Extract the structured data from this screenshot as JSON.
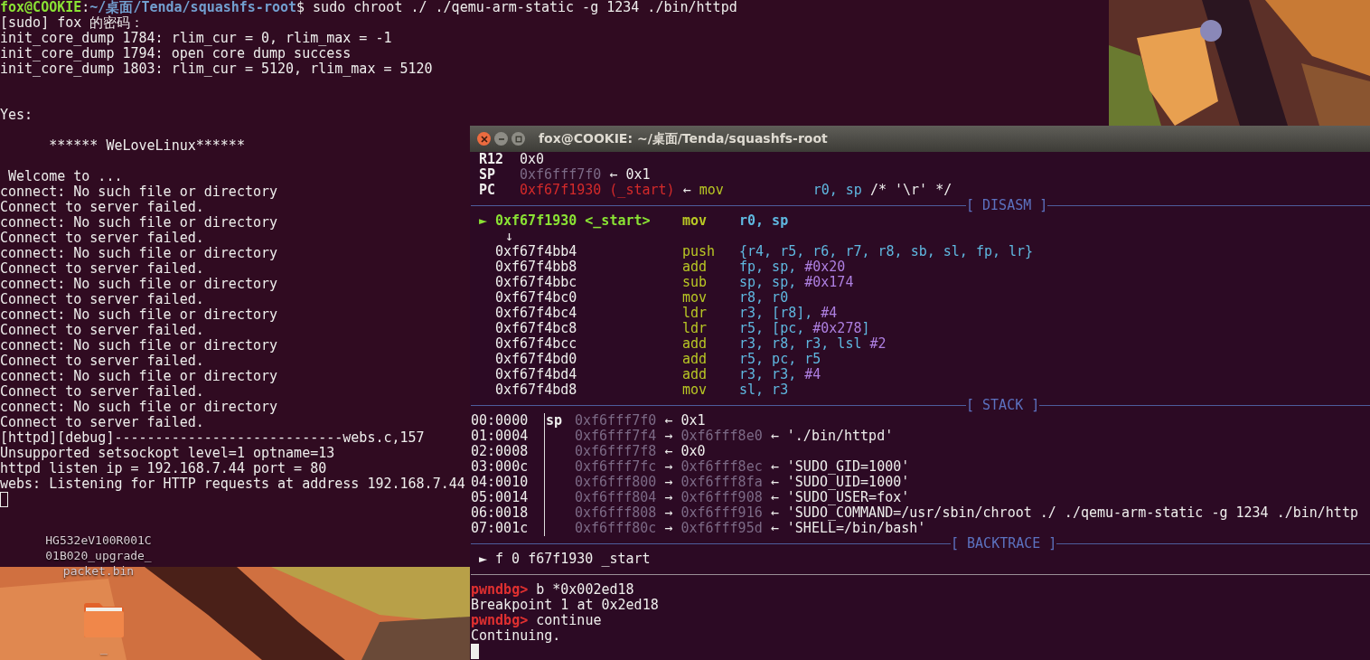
{
  "desktop_icons": [
    {
      "kind": "file",
      "label": "HG532eV100R001C01B020_upgrade_packet.bin"
    },
    {
      "kind": "folder",
      "label": "_"
    }
  ],
  "back_terminal": {
    "prompt": {
      "user": "fox@COOKIE",
      "separator": ":",
      "path": "~/桌面/Tenda/squashfs-root",
      "command": "$ sudo chroot ./ ./qemu-arm-static -g 1234 ./bin/httpd"
    },
    "lines": [
      {
        "kind": "text",
        "text": "[sudo] fox 的密码："
      },
      {
        "kind": "text",
        "text": "init_core_dump 1784: rlim_cur = 0, rlim_max = -1"
      },
      {
        "kind": "text",
        "text": "init_core_dump 1794: open core dump success"
      },
      {
        "kind": "text",
        "text": "init_core_dump 1803: rlim_cur = 5120, rlim_max = 5120"
      },
      {
        "kind": "blank"
      },
      {
        "kind": "blank"
      },
      {
        "kind": "text",
        "text": "Yes:"
      },
      {
        "kind": "blank"
      },
      {
        "kind": "text",
        "text": "      ****** WeLoveLinux******"
      },
      {
        "kind": "blank"
      },
      {
        "kind": "text",
        "text": " Welcome to ..."
      },
      {
        "kind": "text",
        "text": "connect: No such file or directory"
      },
      {
        "kind": "text",
        "text": "Connect to server failed."
      },
      {
        "kind": "text",
        "text": "connect: No such file or directory"
      },
      {
        "kind": "text",
        "text": "Connect to server failed."
      },
      {
        "kind": "text",
        "text": "connect: No such file or directory"
      },
      {
        "kind": "text",
        "text": "Connect to server failed."
      },
      {
        "kind": "text",
        "text": "connect: No such file or directory"
      },
      {
        "kind": "text",
        "text": "Connect to server failed."
      },
      {
        "kind": "text",
        "text": "connect: No such file or directory"
      },
      {
        "kind": "text",
        "text": "Connect to server failed."
      },
      {
        "kind": "text",
        "text": "connect: No such file or directory"
      },
      {
        "kind": "text",
        "text": "Connect to server failed."
      },
      {
        "kind": "text",
        "text": "connect: No such file or directory"
      },
      {
        "kind": "text",
        "text": "Connect to server failed."
      },
      {
        "kind": "text",
        "text": "connect: No such file or directory"
      },
      {
        "kind": "text",
        "text": "Connect to server failed."
      },
      {
        "kind": "text",
        "text": "[httpd][debug]----------------------------webs.c,157"
      },
      {
        "kind": "text",
        "text": "Unsupported setsockopt level=1 optname=13"
      },
      {
        "kind": "text",
        "text": "httpd listen ip = 192.168.7.44 port = 80"
      },
      {
        "kind": "text",
        "text": "webs: Listening for HTTP requests at address 192.168.7.44"
      }
    ],
    "cursor": {
      "focused": false
    }
  },
  "front_terminal": {
    "window": {
      "title": "fox@COOKIE: ~/桌面/Tenda/squashfs-root"
    },
    "registers": [
      {
        "name": "R12",
        "segments": [
          {
            "kind": "plain",
            "text": "0x0"
          }
        ]
      },
      {
        "name": "SP",
        "segments": [
          {
            "kind": "stack",
            "text": "0xf6fff7f0"
          },
          {
            "kind": "plain",
            "text": " ← 0x1"
          }
        ]
      },
      {
        "name": "PC",
        "segments": [
          {
            "kind": "code",
            "text": "0xf67f1930 (_start)"
          },
          {
            "kind": "plain",
            "text": " ← "
          },
          {
            "kind": "op",
            "text": "mov"
          },
          {
            "kind": "reg",
            "text": "r0, sp"
          },
          {
            "kind": "plain",
            "text": " /* '\\r' */"
          }
        ]
      }
    ],
    "disasm_header": "[ DISASM ]",
    "disasm": [
      {
        "kind": "instruction",
        "current": true,
        "marker": "►",
        "addr": "0xf67f1930",
        "label": "<_start>",
        "op": "mov",
        "args": [
          {
            "kind": "reg",
            "text": "r0, sp"
          }
        ]
      },
      {
        "kind": "jump",
        "text": "↓"
      },
      {
        "kind": "instruction",
        "current": false,
        "addr": "0xf67f4bb4",
        "op": "push",
        "args": [
          {
            "kind": "reg",
            "text": "{r4, r5, r6, r7, r8, sb, sl, fp, lr}"
          }
        ]
      },
      {
        "kind": "instruction",
        "current": false,
        "addr": "0xf67f4bb8",
        "op": "add",
        "args": [
          {
            "kind": "reg",
            "text": "fp, sp, "
          },
          {
            "kind": "imm",
            "text": "#0x20"
          }
        ]
      },
      {
        "kind": "instruction",
        "current": false,
        "addr": "0xf67f4bbc",
        "op": "sub",
        "args": [
          {
            "kind": "reg",
            "text": "sp, sp, "
          },
          {
            "kind": "imm",
            "text": "#0x174"
          }
        ]
      },
      {
        "kind": "instruction",
        "current": false,
        "addr": "0xf67f4bc0",
        "op": "mov",
        "args": [
          {
            "kind": "reg",
            "text": "r8, r0"
          }
        ]
      },
      {
        "kind": "instruction",
        "current": false,
        "addr": "0xf67f4bc4",
        "op": "ldr",
        "args": [
          {
            "kind": "reg",
            "text": "r3, [r8], "
          },
          {
            "kind": "imm",
            "text": "#4"
          }
        ]
      },
      {
        "kind": "instruction",
        "current": false,
        "addr": "0xf67f4bc8",
        "op": "ldr",
        "args": [
          {
            "kind": "reg",
            "text": "r5, [pc, "
          },
          {
            "kind": "imm",
            "text": "#0x278"
          },
          {
            "kind": "reg",
            "text": "]"
          }
        ]
      },
      {
        "kind": "instruction",
        "current": false,
        "addr": "0xf67f4bcc",
        "op": "add",
        "args": [
          {
            "kind": "reg",
            "text": "r3, r8, r3, lsl "
          },
          {
            "kind": "imm",
            "text": "#2"
          }
        ]
      },
      {
        "kind": "instruction",
        "current": false,
        "addr": "0xf67f4bd0",
        "op": "add",
        "args": [
          {
            "kind": "reg",
            "text": "r5, pc, r5"
          }
        ]
      },
      {
        "kind": "instruction",
        "current": false,
        "addr": "0xf67f4bd4",
        "op": "add",
        "args": [
          {
            "kind": "reg",
            "text": "r3, r3, "
          },
          {
            "kind": "imm",
            "text": "#4"
          }
        ]
      },
      {
        "kind": "instruction",
        "current": false,
        "addr": "0xf67f4bd8",
        "op": "mov",
        "args": [
          {
            "kind": "reg",
            "text": "sl, r3"
          }
        ]
      }
    ],
    "stack_header": "[ STACK ]",
    "stack": [
      {
        "index": "00:0000",
        "reg": "sp",
        "segments": [
          {
            "kind": "stack",
            "text": "0xf6fff7f0"
          },
          {
            "kind": "plain",
            "text": " ← 0x1"
          }
        ]
      },
      {
        "index": "01:0004",
        "segments": [
          {
            "kind": "stack",
            "text": "0xf6fff7f4"
          },
          {
            "kind": "plain",
            "text": " → "
          },
          {
            "kind": "stack",
            "text": "0xf6fff8e0"
          },
          {
            "kind": "plain",
            "text": " ← './bin/httpd'"
          }
        ]
      },
      {
        "index": "02:0008",
        "segments": [
          {
            "kind": "stack",
            "text": "0xf6fff7f8"
          },
          {
            "kind": "plain",
            "text": " ← 0x0"
          }
        ]
      },
      {
        "index": "03:000c",
        "segments": [
          {
            "kind": "stack",
            "text": "0xf6fff7fc"
          },
          {
            "kind": "plain",
            "text": " → "
          },
          {
            "kind": "stack",
            "text": "0xf6fff8ec"
          },
          {
            "kind": "plain",
            "text": " ← 'SUDO_GID=1000'"
          }
        ]
      },
      {
        "index": "04:0010",
        "segments": [
          {
            "kind": "stack",
            "text": "0xf6fff800"
          },
          {
            "kind": "plain",
            "text": " → "
          },
          {
            "kind": "stack",
            "text": "0xf6fff8fa"
          },
          {
            "kind": "plain",
            "text": " ← 'SUDO_UID=1000'"
          }
        ]
      },
      {
        "index": "05:0014",
        "segments": [
          {
            "kind": "stack",
            "text": "0xf6fff804"
          },
          {
            "kind": "plain",
            "text": " → "
          },
          {
            "kind": "stack",
            "text": "0xf6fff908"
          },
          {
            "kind": "plain",
            "text": " ← 'SUDO_USER=fox'"
          }
        ]
      },
      {
        "index": "06:0018",
        "segments": [
          {
            "kind": "stack",
            "text": "0xf6fff808"
          },
          {
            "kind": "plain",
            "text": " → "
          },
          {
            "kind": "stack",
            "text": "0xf6fff916"
          },
          {
            "kind": "plain",
            "text": " ← 'SUDO_COMMAND=/usr/sbin/chroot ./ ./qemu-arm-static -g 1234 ./bin/http"
          }
        ]
      },
      {
        "index": "07:001c",
        "segments": [
          {
            "kind": "stack",
            "text": "0xf6fff80c"
          },
          {
            "kind": "plain",
            "text": " → "
          },
          {
            "kind": "stack",
            "text": "0xf6fff95d"
          },
          {
            "kind": "plain",
            "text": " ← 'SHELL=/bin/bash'"
          }
        ]
      }
    ],
    "backtrace_header": "[ BACKTRACE ]",
    "backtrace": [
      {
        "marker": "►",
        "text": "f 0 f67f1930 _start"
      }
    ],
    "console": [
      {
        "kind": "command",
        "prompt": "pwndbg>",
        "text": "b *0x002ed18"
      },
      {
        "kind": "output",
        "text": "Breakpoint 1 at 0x2ed18"
      },
      {
        "kind": "command",
        "prompt": "pwndbg>",
        "text": "continue"
      },
      {
        "kind": "output",
        "text": "Continuing."
      }
    ],
    "cursor": {
      "focused": true
    }
  }
}
